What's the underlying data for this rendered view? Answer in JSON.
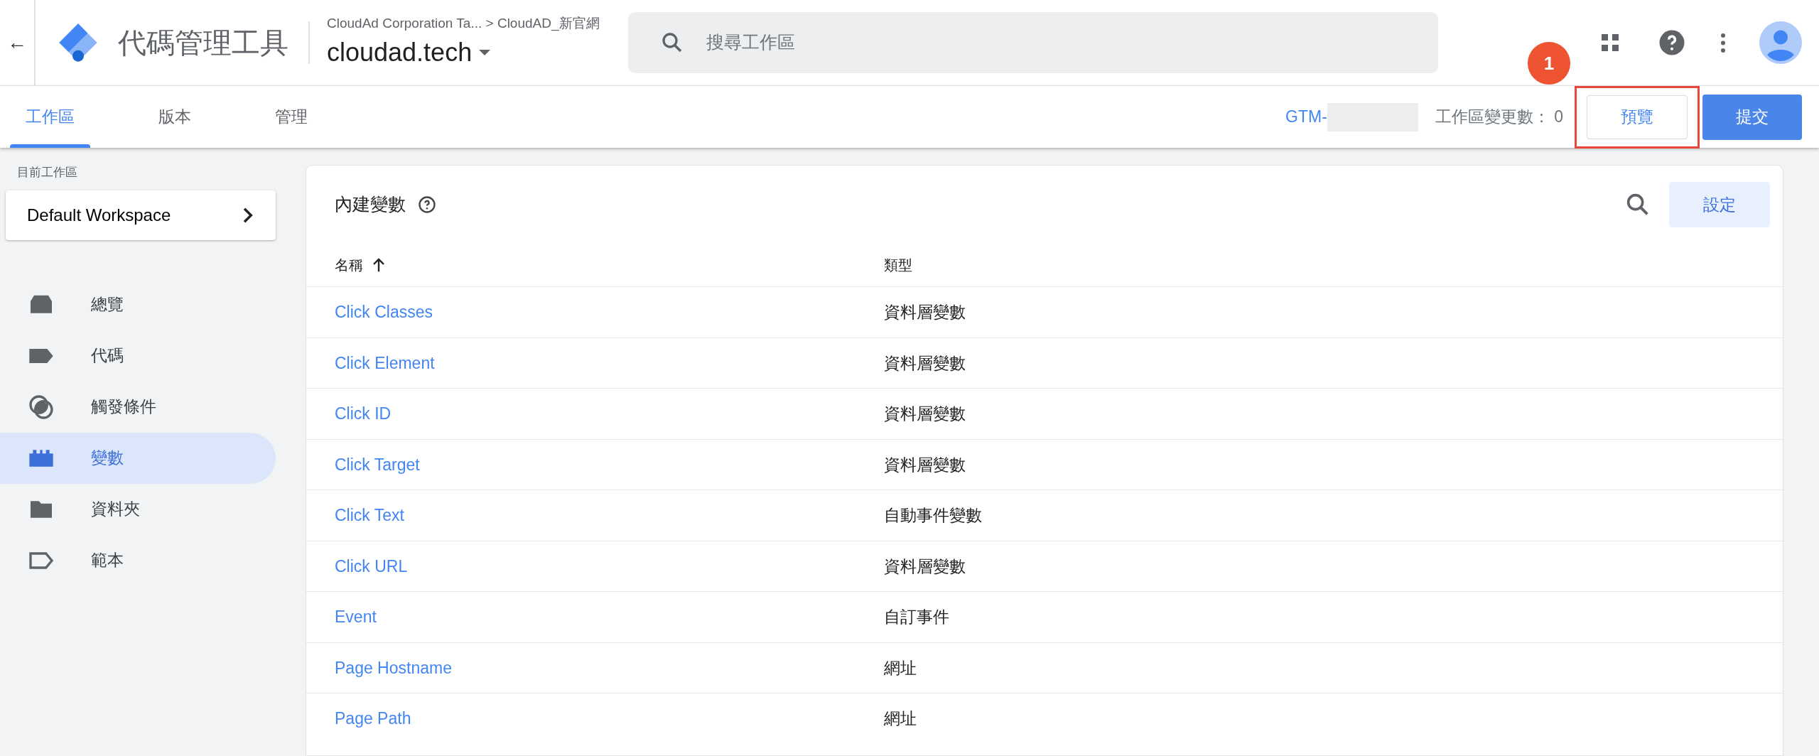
{
  "app": {
    "back": "←",
    "title": "代碼管理工具",
    "breadcrumb": "CloudAd Corporation Ta... > CloudAD_新官網",
    "container": "cloudad.tech"
  },
  "search": {
    "placeholder": "搜尋工作區"
  },
  "annotation": {
    "label": "1"
  },
  "tabs": [
    {
      "label": "工作區",
      "selected": true
    },
    {
      "label": "版本",
      "selected": false
    },
    {
      "label": "管理",
      "selected": false
    }
  ],
  "toolbar": {
    "container_id": "GTM-",
    "changes": "工作區變更數： 0",
    "preview": {
      "label": "預覽",
      "highlighted": true
    },
    "submit": "提交"
  },
  "sidebar": {
    "heading": "目前工作區",
    "workspace": "Default Workspace",
    "items": [
      {
        "label": "總覽",
        "selected": false
      },
      {
        "label": "代碼",
        "selected": false
      },
      {
        "label": "觸發條件",
        "selected": false
      },
      {
        "label": "變數",
        "selected": true
      },
      {
        "label": "資料夾",
        "selected": false
      },
      {
        "label": "範本",
        "selected": false
      }
    ]
  },
  "table": {
    "title": "內建變數",
    "settings": "設定",
    "columns": [
      "名稱",
      "類型"
    ],
    "rows": [
      {
        "name": "Click Classes",
        "type": "資料層變數"
      },
      {
        "name": "Click Element",
        "type": "資料層變數"
      },
      {
        "name": "Click ID",
        "type": "資料層變數"
      },
      {
        "name": "Click Target",
        "type": "資料層變數"
      },
      {
        "name": "Click Text",
        "type": "自動事件變數"
      },
      {
        "name": "Click URL",
        "type": "資料層變數"
      },
      {
        "name": "Event",
        "type": "自訂事件"
      },
      {
        "name": "Page Hostname",
        "type": "網址"
      },
      {
        "name": "Page Path",
        "type": "網址"
      }
    ]
  }
}
